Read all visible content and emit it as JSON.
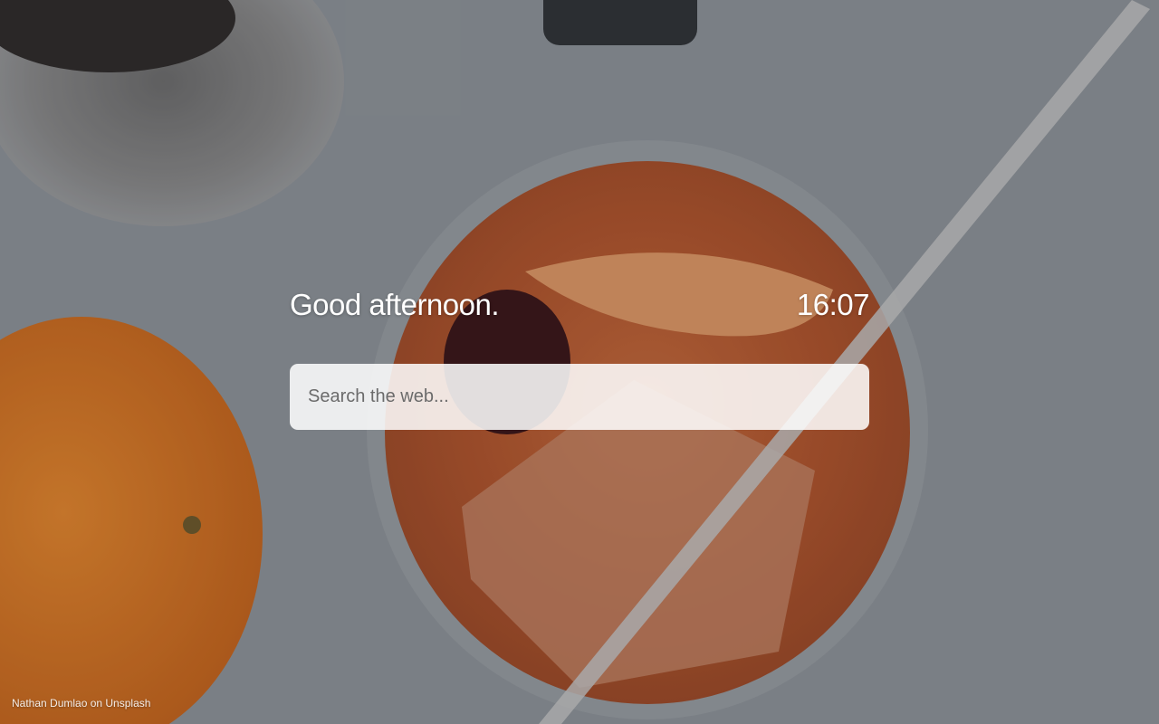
{
  "greeting": "Good afternoon.",
  "clock": "16:07",
  "search": {
    "placeholder": "Search the web..."
  },
  "credit": "Nathan Dumlao on Unsplash",
  "colors": {
    "overlay_text": "#ffffff",
    "search_bg": "#f2f0ef",
    "placeholder": "#6b6b6b"
  }
}
